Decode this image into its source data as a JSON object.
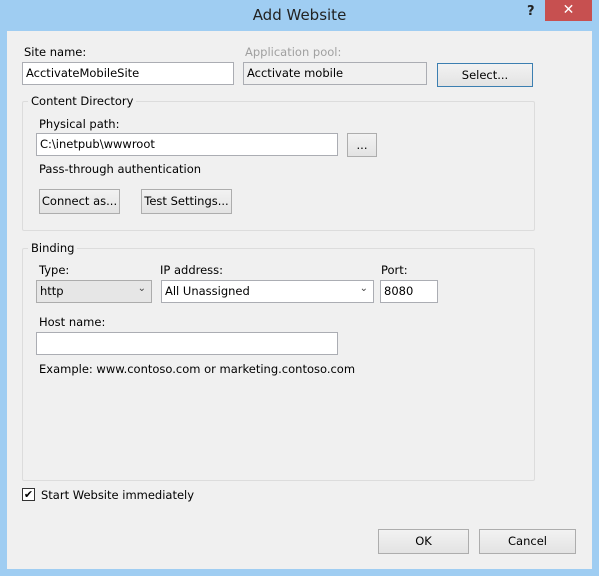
{
  "window": {
    "title": "Add Website",
    "help": "?",
    "close": "✕"
  },
  "site": {
    "label": "Site name:",
    "value": "AcctivateMobileSite"
  },
  "pool": {
    "label": "Application pool:",
    "value": "Acctivate mobile",
    "select": "Select..."
  },
  "content": {
    "legend": "Content Directory",
    "path_label": "Physical path:",
    "path_value": "C:\\inetpub\\wwwroot",
    "browse": "...",
    "auth": "Pass-through authentication",
    "connect": "Connect as...",
    "test": "Test Settings..."
  },
  "binding": {
    "legend": "Binding",
    "type_label": "Type:",
    "type_value": "http",
    "ip_label": "IP address:",
    "ip_value": "All Unassigned",
    "port_label": "Port:",
    "port_value": "8080",
    "host_label": "Host name:",
    "host_value": "",
    "example": "Example: www.contoso.com or marketing.contoso.com"
  },
  "start": {
    "label": "Start Website immediately",
    "checked": true,
    "mark": "✔"
  },
  "buttons": {
    "ok": "OK",
    "cancel": "Cancel"
  }
}
